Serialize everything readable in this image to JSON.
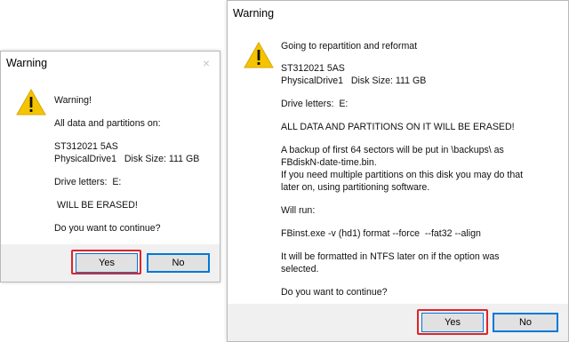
{
  "left_dialog": {
    "title": "Warning",
    "close_glyph": "×",
    "lines": {
      "heading": "Warning!",
      "intro": "All data and partitions on:",
      "model": "ST312021 5AS",
      "drive_info": "PhysicalDrive1   Disk Size: 111 GB",
      "drive_letters": "Drive letters:  E:",
      "erase": " WILL BE ERASED!",
      "question": "Do you want to continue?"
    },
    "yes_label": "Yes",
    "no_label": "No"
  },
  "right_dialog": {
    "title": "Warning",
    "lines": {
      "heading": "Going to repartition and reformat",
      "model": "ST312021 5AS",
      "drive_info": "PhysicalDrive1   Disk Size: 111 GB",
      "drive_letters": "Drive letters:  E:",
      "erase": "ALL DATA AND PARTITIONS ON IT WILL BE ERASED!",
      "backup_1": "A backup of first 64 sectors will be put in \\backups\\ as",
      "backup_2": "FBdiskN-date-time.bin.",
      "backup_3": "If you need multiple partitions on this disk you may do that",
      "backup_4": "later on, using partitioning software.",
      "will_run": "Will run:",
      "command": "FBinst.exe -v (hd1) format --force  --fat32 --align",
      "ntfs_1": "It will be formatted in NTFS later on if the option was",
      "ntfs_2": "selected.",
      "question": "Do you want to continue?"
    },
    "yes_label": "Yes",
    "no_label": "No"
  },
  "colors": {
    "highlight": "#e0242a",
    "focus_border": "#0078d7",
    "warning_yellow": "#f5c400",
    "footer_bg": "#f0f0f0"
  },
  "icons": [
    "warning-icon",
    "close-icon"
  ]
}
